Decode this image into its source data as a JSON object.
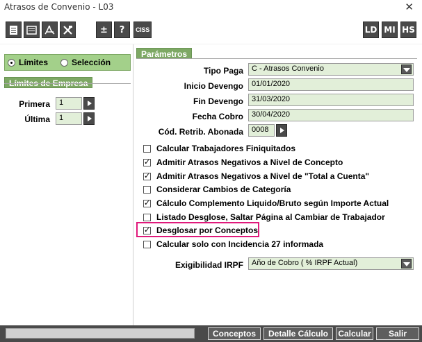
{
  "window": {
    "title": "Atrasos de Convenio - L03",
    "close_glyph": "✕"
  },
  "toolbar": {
    "left_buttons": [
      {
        "name": "print-icon",
        "glyph": "▤"
      },
      {
        "name": "document-icon",
        "glyph": "▥"
      },
      {
        "name": "pdf-icon",
        "glyph": "⅄"
      },
      {
        "name": "excel-icon",
        "glyph": "X"
      },
      {
        "name": "plus-minus-icon",
        "glyph": "±"
      },
      {
        "name": "help-icon",
        "glyph": "?"
      },
      {
        "name": "ciss-logo",
        "glyph": "CISS"
      }
    ],
    "right_buttons": [
      "LD",
      "MI",
      "HS"
    ]
  },
  "selection": {
    "options": [
      {
        "label": "Límites",
        "selected": true
      },
      {
        "label": "Selección",
        "selected": false
      }
    ]
  },
  "limits": {
    "title": "Límites de Empresa",
    "primera_label": "Primera",
    "primera_value": "1",
    "ultima_label": "Última",
    "ultima_value": "1"
  },
  "params": {
    "title": "Parámetros",
    "tipo_paga_label": "Tipo Paga",
    "tipo_paga_value": "C - Atrasos Convenio",
    "inicio_label": "Inicio Devengo",
    "inicio_value": "01/01/2020",
    "fin_label": "Fin Devengo",
    "fin_value": "31/03/2020",
    "cobro_label": "Fecha Cobro",
    "cobro_value": "30/04/2020",
    "retrib_label": "Cód. Retrib. Abonada",
    "retrib_value": "0008",
    "checks": [
      {
        "label": "Calcular Trabajadores Finiquitados",
        "checked": false
      },
      {
        "label": "Admitir Atrasos Negativos a Nivel de Concepto",
        "checked": true
      },
      {
        "label": "Admitir Atrasos Negativos a Nivel de \"Total a Cuenta\"",
        "checked": true
      },
      {
        "label": "Considerar Cambios de Categoría",
        "checked": false
      },
      {
        "label": "Cálculo Complemento Liquido/Bruto según Importe Actual",
        "checked": true
      },
      {
        "label": "Listado Desglose, Saltar Página al Cambiar de Trabajador",
        "checked": false
      },
      {
        "label": "Desglosar por Conceptos",
        "checked": true
      },
      {
        "label": "Calcular solo con Incidencia 27 informada",
        "checked": false
      }
    ],
    "irpf_label": "Exigibilidad IRPF",
    "irpf_value": "Año de Cobro ( % IRPF Actual)"
  },
  "footer": {
    "conceptos": "Conceptos",
    "detalle": "Detalle Cálculo",
    "calcular": "Calcular",
    "salir": "Salir"
  }
}
